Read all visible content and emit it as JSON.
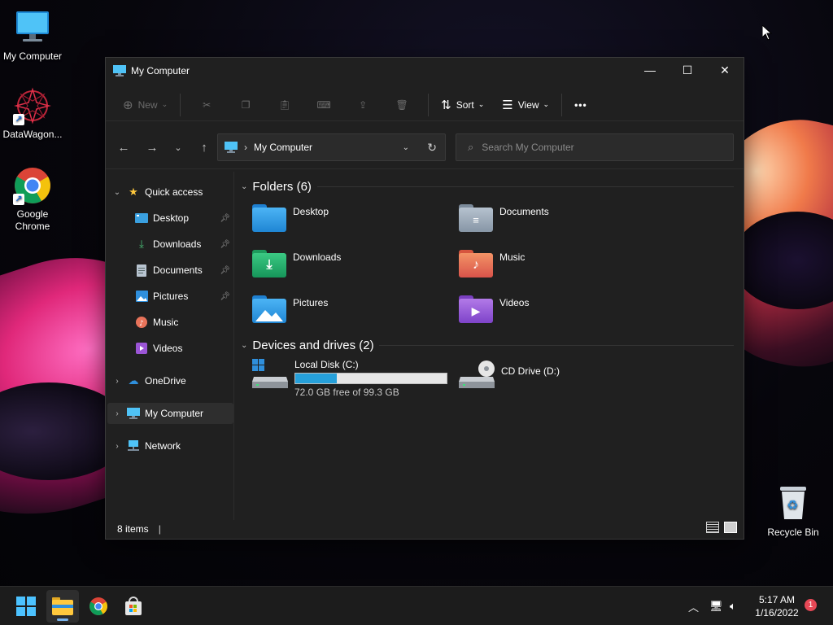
{
  "desktop": {
    "icons": [
      {
        "label": "My Computer"
      },
      {
        "label": "DataWagon..."
      },
      {
        "label": "Google Chrome"
      }
    ],
    "recycle_bin": "Recycle Bin"
  },
  "window": {
    "title": "My Computer",
    "controls": {
      "minimize": "—",
      "maximize": "☐",
      "close": "✕"
    },
    "commands": {
      "new": "New",
      "sort": "Sort",
      "view": "View",
      "more": "•••"
    },
    "address": {
      "path": "My Computer"
    },
    "search": {
      "placeholder": "Search My Computer"
    },
    "sidebar": {
      "quick_access": "Quick access",
      "items": [
        {
          "label": "Desktop"
        },
        {
          "label": "Downloads"
        },
        {
          "label": "Documents"
        },
        {
          "label": "Pictures"
        },
        {
          "label": "Music"
        },
        {
          "label": "Videos"
        }
      ],
      "onedrive": "OneDrive",
      "my_computer": "My Computer",
      "network": "Network"
    },
    "folders": {
      "heading": "Folders (6)",
      "items": [
        {
          "name": "Desktop"
        },
        {
          "name": "Documents"
        },
        {
          "name": "Downloads"
        },
        {
          "name": "Music"
        },
        {
          "name": "Pictures"
        },
        {
          "name": "Videos"
        }
      ]
    },
    "drives": {
      "heading": "Devices and drives (2)",
      "local": {
        "name": "Local Disk (C:)",
        "free_text": "72.0 GB free of 99.3 GB",
        "used_fraction": 0.275
      },
      "cd": {
        "name": "CD Drive (D:)"
      }
    },
    "status": {
      "count": "8 items",
      "caret": "|"
    }
  },
  "taskbar": {
    "time": "5:17 AM",
    "date": "1/16/2022",
    "notification_count": "1"
  }
}
